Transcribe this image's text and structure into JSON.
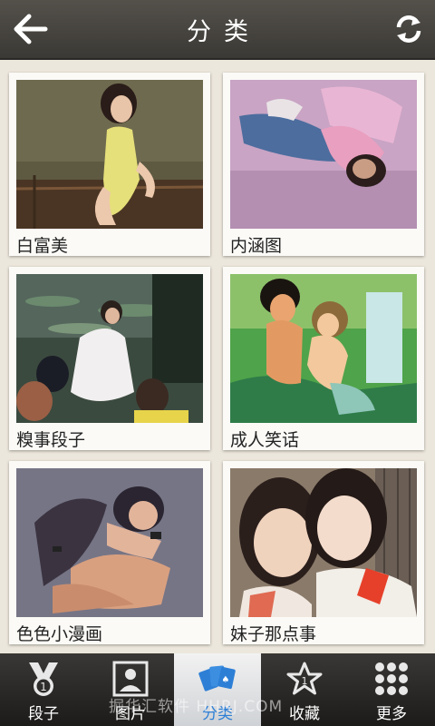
{
  "header": {
    "title": "分类",
    "back_icon": "arrow-left-icon",
    "refresh_icon": "refresh-icon"
  },
  "categories": [
    {
      "label": "白富美"
    },
    {
      "label": "内涵图"
    },
    {
      "label": "糗事段子"
    },
    {
      "label": "成人笑话"
    },
    {
      "label": "色色小漫画"
    },
    {
      "label": "妹子那点事"
    }
  ],
  "tabs": [
    {
      "label": "段子",
      "icon": "medal-icon"
    },
    {
      "label": "图片",
      "icon": "picture-icon"
    },
    {
      "label": "分类",
      "icon": "cards-icon",
      "active": true
    },
    {
      "label": "收藏",
      "icon": "star-icon"
    },
    {
      "label": "更多",
      "icon": "grid-icon"
    }
  ],
  "watermark": "掘华汇软件 HHRJ.COM",
  "colors": {
    "header": "#48453f",
    "background": "#ece7dc",
    "active_tab_text": "#2d7fd6"
  }
}
